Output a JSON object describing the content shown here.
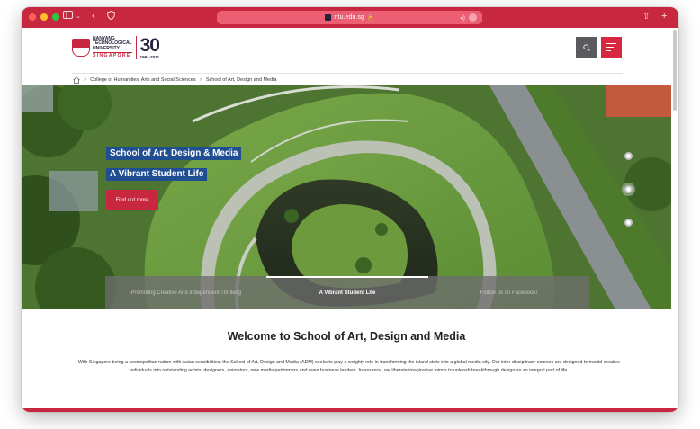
{
  "browser": {
    "url": "ntu.edu.sg",
    "icons": [
      "sidebar-icon",
      "chevron-down-icon",
      "back-icon",
      "shield-icon",
      "lock-icon",
      "speaker-icon",
      "share-icon",
      "new-tab-icon"
    ]
  },
  "header": {
    "logo": {
      "line1": "NANYANG",
      "line2": "TECHNOLOGICAL",
      "line3": "UNIVERSITY",
      "line4": "SINGAPORE",
      "anniversary": "30",
      "years": "1991-2021"
    },
    "search_icon": "search-icon",
    "menu_icon": "menu-icon"
  },
  "breadcrumb": {
    "items": [
      "College of Humanities, Arts and Social Sciences",
      "School of Art, Design and Media"
    ],
    "separator": ">"
  },
  "hero": {
    "title1": "School of Art, Design & Media",
    "title2": "A Vibrant Student Life",
    "cta": "Find out more",
    "tabs": [
      "Promoting Creative And Independent Thinking",
      "A Vibrant Student Life",
      "Follow us on Facebook!"
    ],
    "active_tab": 1,
    "dots": 3,
    "active_dot": 1
  },
  "welcome": {
    "title": "Welcome to School of Art, Design and Media",
    "body": "With Singapore being a cosmopolitan nation with Asian sensibilities, the School of Art, Design and Media (ADM) seeks to play a weighty role in transforming the island state into a global media city. Our inter-disciplinary courses are designed to mould creative individuals into outstanding artists, designers, animators, new media performers and even business leaders. In essence, we liberate imaginative minds to unleash breakthrough design as an integral part of life."
  },
  "colors": {
    "brand_red": "#c8283f",
    "navy": "#23223d",
    "title_blue": "#1f4e92"
  }
}
